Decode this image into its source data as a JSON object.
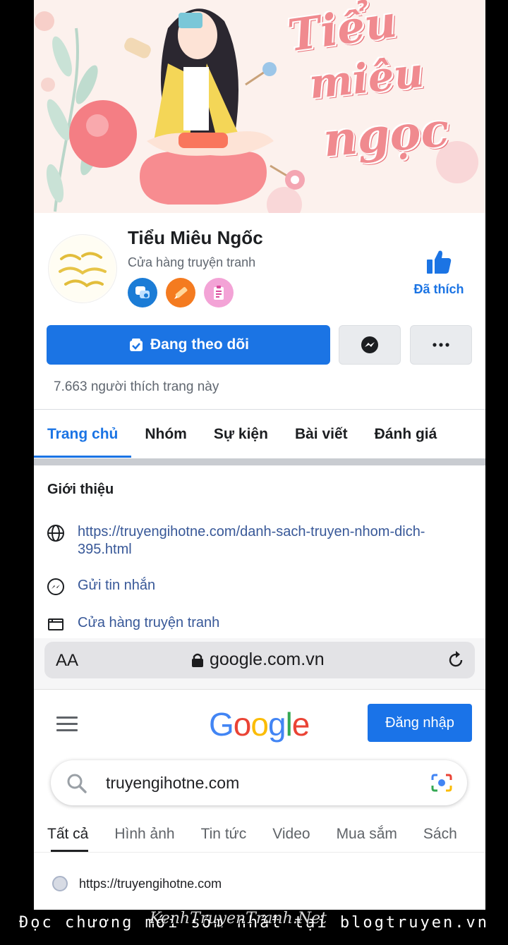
{
  "cover": {
    "title_lines": [
      "Tiểu",
      "miêu",
      "ngọc"
    ]
  },
  "profile": {
    "name": "Tiểu Miêu Ngốc",
    "category": "Cửa hàng truyện tranh",
    "badges": [
      "chat-badge-icon",
      "pencil-badge-icon",
      "clipboard-badge-icon"
    ],
    "liked_label": "Đã thích",
    "follow_label": "Đang theo dõi",
    "likes_count": "7.663 người thích trang này"
  },
  "tabs": [
    "Trang chủ",
    "Nhóm",
    "Sự kiện",
    "Bài viết",
    "Đánh giá"
  ],
  "intro": {
    "title": "Giới thiệu",
    "website": "https://truyengihotne.com/danh-sach-truyen-nhom-dich-395.html",
    "message": "Gửi tin nhắn",
    "category": "Cửa hàng truyện tranh"
  },
  "browser": {
    "aa": "AA",
    "domain": "google.com.vn"
  },
  "google": {
    "logo": [
      "G",
      "o",
      "o",
      "g",
      "l",
      "e"
    ],
    "logo_colors": [
      "#4285f4",
      "#ea4335",
      "#fbbc05",
      "#4285f4",
      "#34a853",
      "#ea4335"
    ],
    "signin_label": "Đăng nhập",
    "query": "truyengihotne.com",
    "tabs": [
      "Tất cả",
      "Hình ảnh",
      "Tin tức",
      "Video",
      "Mua sắm",
      "Sách"
    ],
    "result_url": "https://truyengihotne.com"
  },
  "watermark": {
    "text": "Đọc chương mới sớm nhất tại blogtruyen.vn",
    "overlay": "KenhTruyenTranh.Net"
  },
  "colors": {
    "facebook_blue": "#1b74e4",
    "google_blue": "#1a73e8",
    "cover_pink": "#f08a8f"
  }
}
